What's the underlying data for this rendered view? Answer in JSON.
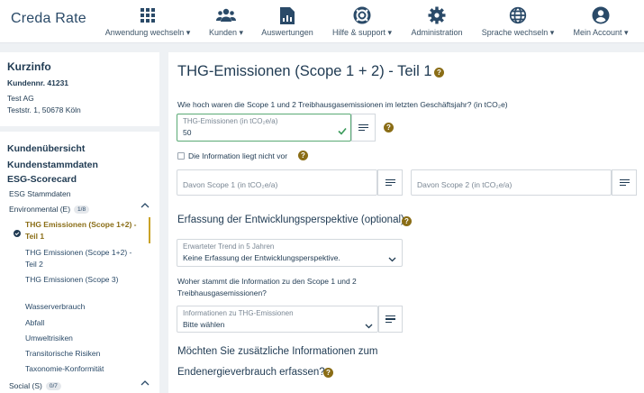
{
  "header": {
    "logo_text": "Creda Rate",
    "nav": [
      {
        "label": "Anwendung wechseln ▾",
        "icon": "grid-icon"
      },
      {
        "label": "Kunden ▾",
        "icon": "users-icon"
      },
      {
        "label": "Auswertungen",
        "icon": "report-icon"
      },
      {
        "label": "Hilfe & support ▾",
        "icon": "lifebuoy-icon"
      },
      {
        "label": "Administration",
        "icon": "gear-icon"
      },
      {
        "label": "Sprache wechseln ▾",
        "icon": "globe-icon"
      },
      {
        "label": "Mein Account ▾",
        "icon": "account-icon"
      }
    ]
  },
  "kurzinfo": {
    "title": "Kurzinfo",
    "kundennr": "Kundennr. 41231",
    "company": "Test AG",
    "address": "Teststr. 1, 50678 Köln"
  },
  "sidebar": {
    "kundenuebersicht": "Kundenübersicht",
    "kundenstammdaten": "Kundenstammdaten",
    "esg_scorecard": "ESG-Scorecard",
    "esg_stammdaten": "ESG Stammdaten",
    "environmental": {
      "label": "Environmental (E)",
      "badge": "1/8"
    },
    "env_items": [
      {
        "label": "THG Emissionen (Scope 1+2) - Teil 1"
      },
      {
        "label": "THG Emissionen (Scope 1+2) - Teil 2"
      },
      {
        "label": "THG Emissionen (Scope 3)"
      },
      {
        "label": "Wasserverbrauch"
      },
      {
        "label": "Abfall"
      },
      {
        "label": "Umweltrisiken"
      },
      {
        "label": "Transitorische Risiken"
      },
      {
        "label": "Taxonomie-Konformität"
      }
    ],
    "social": {
      "label": "Social (S)",
      "badge": "0/7"
    }
  },
  "content": {
    "title": "THG-Emissionen (Scope 1 + 2) - Teil 1",
    "question1": "Wie hoch waren die Scope 1 und 2 Treibhausgasemissionen im letzten Geschäftsjahr? (in tCO₂e)",
    "field1_label": "THG-Emissionen (in tCO₂e/a)",
    "field1_value": "50",
    "checkbox_label": "Die Information liegt nicht vor",
    "scope1_placeholder": "Davon Scope 1 (in tCO₂e/a)",
    "scope2_placeholder": "Davon Scope 2 (in tCO₂e/a)",
    "section2": "Erfassung der Entwicklungsperspektive (optional)",
    "trend_label": "Erwarteter Trend in 5 Jahren",
    "trend_value": "Keine Erfassung der Entwicklungsperspektive.",
    "question2_line1": "Woher stammt die Information zu den Scope 1 und 2",
    "question2_line2": "Treibhausgasemissionen?",
    "source_label": "Informationen zu THG-Emissionen",
    "source_value": "Bitte wählen",
    "section3_line1": "Möchten Sie zusätzliche Informationen zum",
    "section3_line2": "Endenergieverbrauch erfassen?"
  },
  "colors": {
    "accent": "#8a6d16",
    "success": "#3a9a5a",
    "text": "#1f3a52",
    "background": "#eef1f4"
  }
}
